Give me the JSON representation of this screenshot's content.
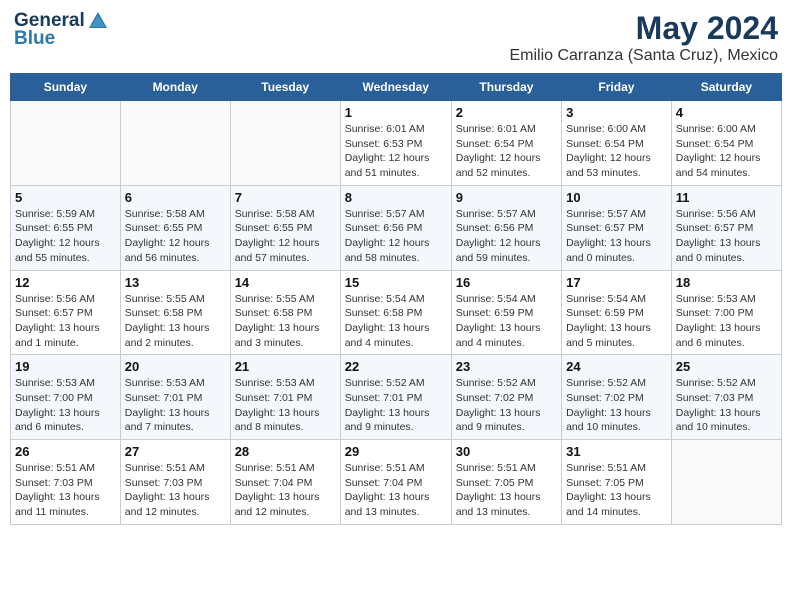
{
  "app": {
    "logo_general": "General",
    "logo_blue": "Blue",
    "title": "May 2024",
    "subtitle": "Emilio Carranza (Santa Cruz), Mexico"
  },
  "calendar": {
    "headers": [
      "Sunday",
      "Monday",
      "Tuesday",
      "Wednesday",
      "Thursday",
      "Friday",
      "Saturday"
    ],
    "weeks": [
      [
        {
          "day": "",
          "info": ""
        },
        {
          "day": "",
          "info": ""
        },
        {
          "day": "",
          "info": ""
        },
        {
          "day": "1",
          "info": "Sunrise: 6:01 AM\nSunset: 6:53 PM\nDaylight: 12 hours\nand 51 minutes."
        },
        {
          "day": "2",
          "info": "Sunrise: 6:01 AM\nSunset: 6:54 PM\nDaylight: 12 hours\nand 52 minutes."
        },
        {
          "day": "3",
          "info": "Sunrise: 6:00 AM\nSunset: 6:54 PM\nDaylight: 12 hours\nand 53 minutes."
        },
        {
          "day": "4",
          "info": "Sunrise: 6:00 AM\nSunset: 6:54 PM\nDaylight: 12 hours\nand 54 minutes."
        }
      ],
      [
        {
          "day": "5",
          "info": "Sunrise: 5:59 AM\nSunset: 6:55 PM\nDaylight: 12 hours\nand 55 minutes."
        },
        {
          "day": "6",
          "info": "Sunrise: 5:58 AM\nSunset: 6:55 PM\nDaylight: 12 hours\nand 56 minutes."
        },
        {
          "day": "7",
          "info": "Sunrise: 5:58 AM\nSunset: 6:55 PM\nDaylight: 12 hours\nand 57 minutes."
        },
        {
          "day": "8",
          "info": "Sunrise: 5:57 AM\nSunset: 6:56 PM\nDaylight: 12 hours\nand 58 minutes."
        },
        {
          "day": "9",
          "info": "Sunrise: 5:57 AM\nSunset: 6:56 PM\nDaylight: 12 hours\nand 59 minutes."
        },
        {
          "day": "10",
          "info": "Sunrise: 5:57 AM\nSunset: 6:57 PM\nDaylight: 13 hours\nand 0 minutes."
        },
        {
          "day": "11",
          "info": "Sunrise: 5:56 AM\nSunset: 6:57 PM\nDaylight: 13 hours\nand 0 minutes."
        }
      ],
      [
        {
          "day": "12",
          "info": "Sunrise: 5:56 AM\nSunset: 6:57 PM\nDaylight: 13 hours\nand 1 minute."
        },
        {
          "day": "13",
          "info": "Sunrise: 5:55 AM\nSunset: 6:58 PM\nDaylight: 13 hours\nand 2 minutes."
        },
        {
          "day": "14",
          "info": "Sunrise: 5:55 AM\nSunset: 6:58 PM\nDaylight: 13 hours\nand 3 minutes."
        },
        {
          "day": "15",
          "info": "Sunrise: 5:54 AM\nSunset: 6:58 PM\nDaylight: 13 hours\nand 4 minutes."
        },
        {
          "day": "16",
          "info": "Sunrise: 5:54 AM\nSunset: 6:59 PM\nDaylight: 13 hours\nand 4 minutes."
        },
        {
          "day": "17",
          "info": "Sunrise: 5:54 AM\nSunset: 6:59 PM\nDaylight: 13 hours\nand 5 minutes."
        },
        {
          "day": "18",
          "info": "Sunrise: 5:53 AM\nSunset: 7:00 PM\nDaylight: 13 hours\nand 6 minutes."
        }
      ],
      [
        {
          "day": "19",
          "info": "Sunrise: 5:53 AM\nSunset: 7:00 PM\nDaylight: 13 hours\nand 6 minutes."
        },
        {
          "day": "20",
          "info": "Sunrise: 5:53 AM\nSunset: 7:01 PM\nDaylight: 13 hours\nand 7 minutes."
        },
        {
          "day": "21",
          "info": "Sunrise: 5:53 AM\nSunset: 7:01 PM\nDaylight: 13 hours\nand 8 minutes."
        },
        {
          "day": "22",
          "info": "Sunrise: 5:52 AM\nSunset: 7:01 PM\nDaylight: 13 hours\nand 9 minutes."
        },
        {
          "day": "23",
          "info": "Sunrise: 5:52 AM\nSunset: 7:02 PM\nDaylight: 13 hours\nand 9 minutes."
        },
        {
          "day": "24",
          "info": "Sunrise: 5:52 AM\nSunset: 7:02 PM\nDaylight: 13 hours\nand 10 minutes."
        },
        {
          "day": "25",
          "info": "Sunrise: 5:52 AM\nSunset: 7:03 PM\nDaylight: 13 hours\nand 10 minutes."
        }
      ],
      [
        {
          "day": "26",
          "info": "Sunrise: 5:51 AM\nSunset: 7:03 PM\nDaylight: 13 hours\nand 11 minutes."
        },
        {
          "day": "27",
          "info": "Sunrise: 5:51 AM\nSunset: 7:03 PM\nDaylight: 13 hours\nand 12 minutes."
        },
        {
          "day": "28",
          "info": "Sunrise: 5:51 AM\nSunset: 7:04 PM\nDaylight: 13 hours\nand 12 minutes."
        },
        {
          "day": "29",
          "info": "Sunrise: 5:51 AM\nSunset: 7:04 PM\nDaylight: 13 hours\nand 13 minutes."
        },
        {
          "day": "30",
          "info": "Sunrise: 5:51 AM\nSunset: 7:05 PM\nDaylight: 13 hours\nand 13 minutes."
        },
        {
          "day": "31",
          "info": "Sunrise: 5:51 AM\nSunset: 7:05 PM\nDaylight: 13 hours\nand 14 minutes."
        },
        {
          "day": "",
          "info": ""
        }
      ]
    ]
  }
}
